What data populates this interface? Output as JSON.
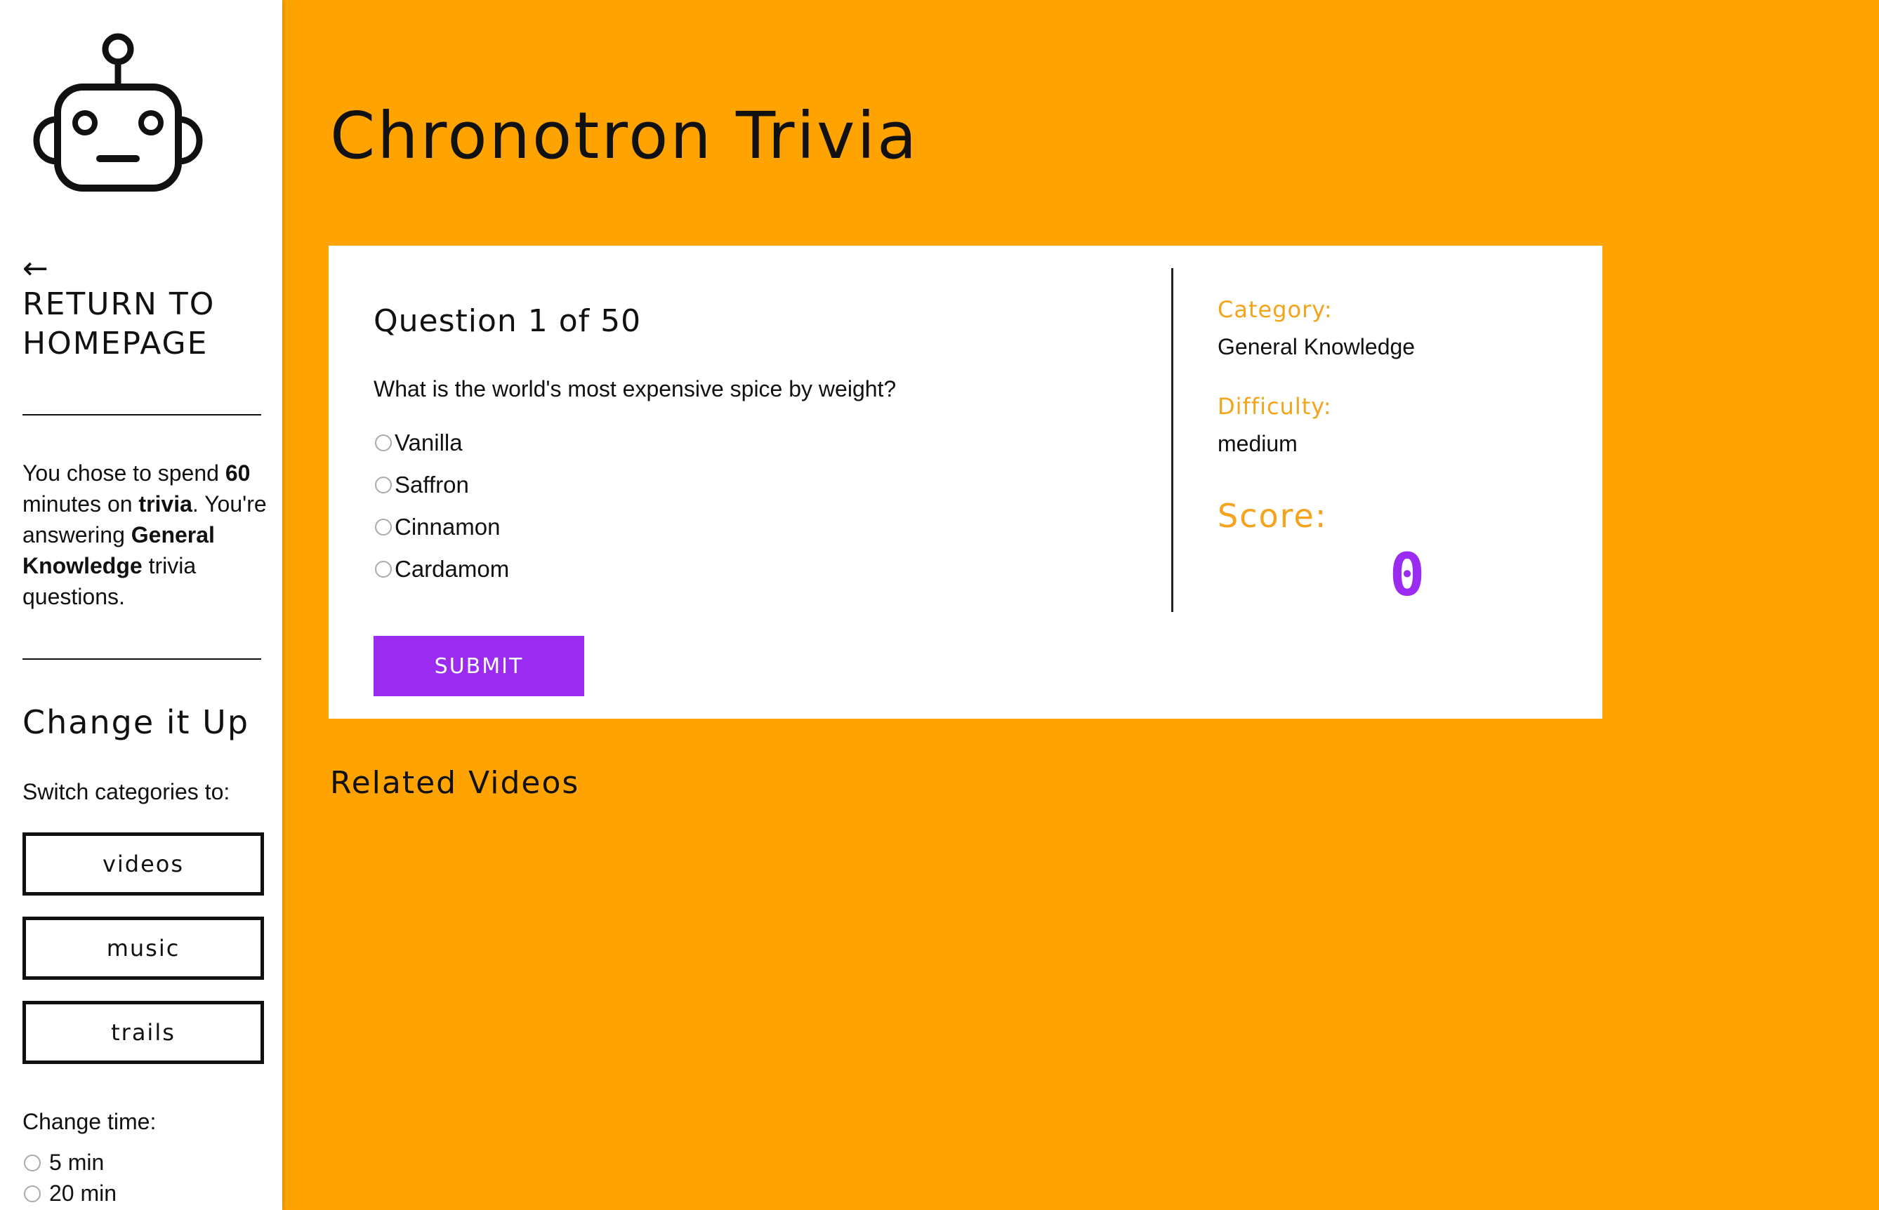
{
  "sidebar": {
    "logo_icon": "robot-icon",
    "back_arrow": "←",
    "back_line1": "RETURN TO",
    "back_line2": "HOMEPAGE",
    "summary": {
      "part1": "You chose to spend ",
      "minutes": "60",
      "part2": " minutes on ",
      "activity": "trivia",
      "part3": ". You're answering ",
      "category": "General Knowledge",
      "part4": " trivia questions."
    },
    "change_title": "Change it Up",
    "switch_label": "Switch categories to:",
    "categories": [
      "videos",
      "music",
      "trails"
    ],
    "time_label": "Change time:",
    "time_options": [
      "5 min",
      "20 min"
    ]
  },
  "main": {
    "title": "Chronotron Trivia",
    "question_heading": "Question 1 of 50",
    "question_text": "What is the world's most expensive spice by weight?",
    "answers": [
      "Vanilla",
      "Saffron",
      "Cinnamon",
      "Cardamom"
    ],
    "submit_label": "SUBMIT",
    "category_label": "Category:",
    "category_value": "General Knowledge",
    "difficulty_label": "Difficulty:",
    "difficulty_value": "medium",
    "score_label": "Score:",
    "score_value": "0",
    "related_title": "Related Videos"
  },
  "colors": {
    "background": "#ffa300",
    "accent_purple": "#9b2bf0",
    "label_orange": "#f5a31a"
  }
}
